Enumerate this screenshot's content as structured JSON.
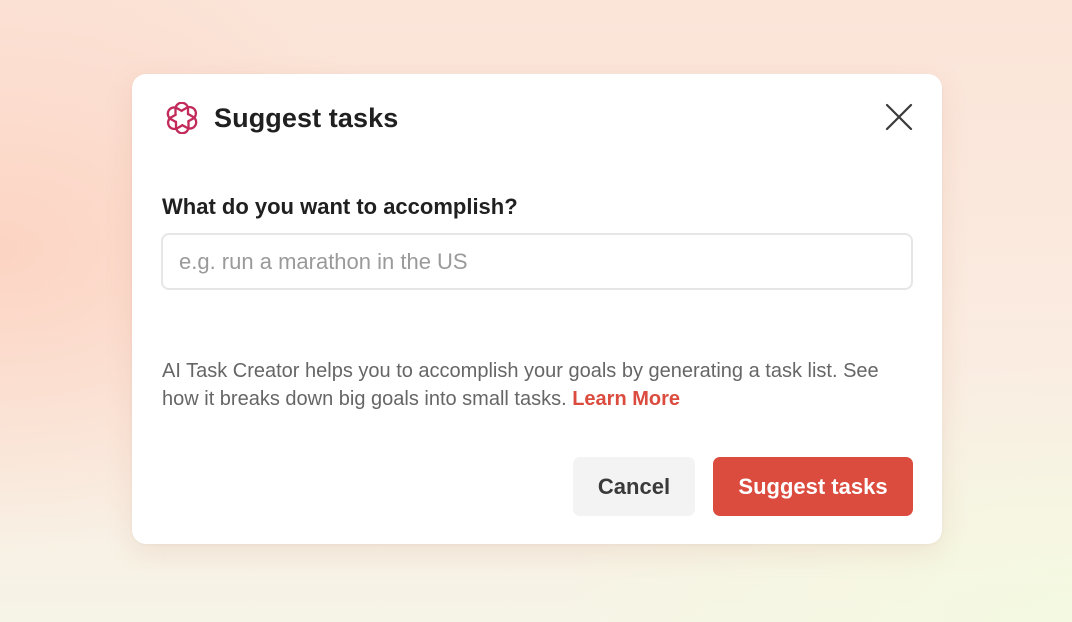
{
  "dialog": {
    "title": "Suggest tasks",
    "logo_icon": "openai-logo-icon",
    "close_icon": "close-icon",
    "accent_color": "#db4c3f",
    "logo_color": "#c22a5a"
  },
  "form": {
    "label": "What do you want to accomplish?",
    "input": {
      "value": "",
      "placeholder": "e.g. run a marathon in the US"
    }
  },
  "description": {
    "text": "AI Task Creator helps you to accomplish your goals by generating a task list. See how it breaks down big goals into small tasks.",
    "link_label": "Learn More"
  },
  "actions": {
    "cancel_label": "Cancel",
    "submit_label": "Suggest tasks"
  }
}
